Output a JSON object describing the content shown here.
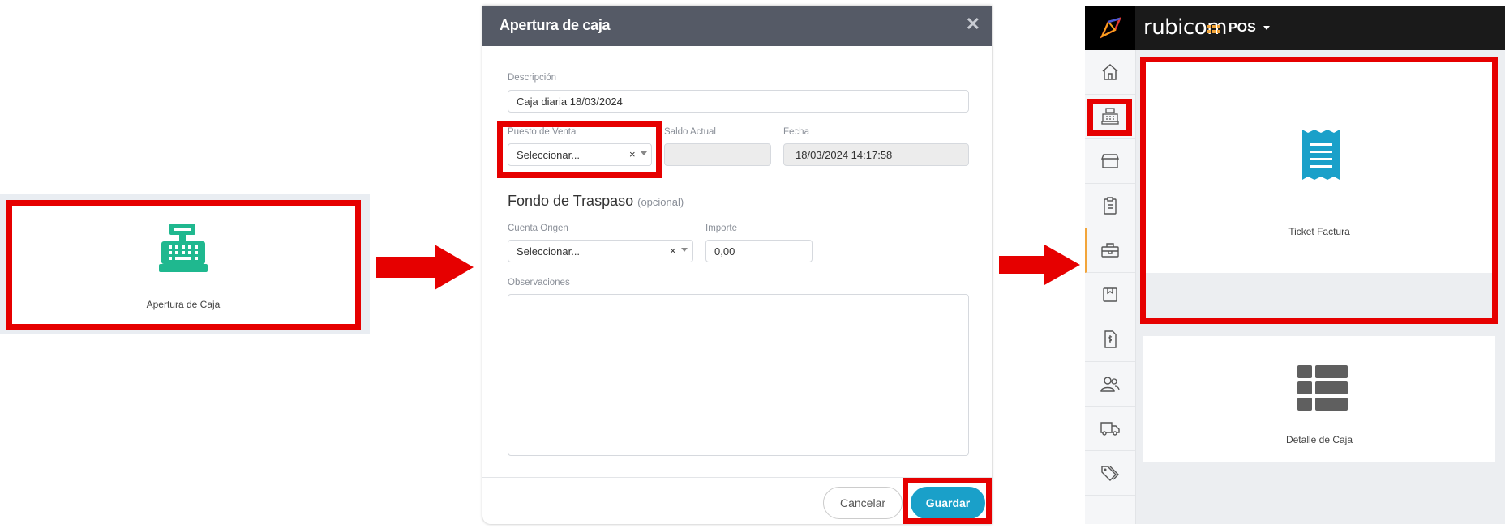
{
  "panel1": {
    "tile_label": "Apertura de Caja"
  },
  "modal": {
    "title": "Apertura de caja",
    "close_glyph": "✕",
    "descripcion_label": "Descripción",
    "descripcion_value": "Caja diaria 18/03/2024",
    "puesto_label": "Puesto de Venta",
    "puesto_value": "Seleccionar...",
    "saldo_label": "Saldo Actual",
    "saldo_value": "",
    "fecha_label": "Fecha",
    "fecha_value": "18/03/2024 14:17:58",
    "section_title": "Fondo de Traspaso",
    "section_optional": "(opcional)",
    "cuenta_label": "Cuenta Origen",
    "cuenta_value": "Seleccionar...",
    "importe_label": "Importe",
    "importe_value": "0,00",
    "observaciones_label": "Observaciones",
    "observaciones_value": "",
    "clear_glyph": "×",
    "cancel_label": "Cancelar",
    "save_label": "Guardar"
  },
  "app": {
    "brand": "rubicom",
    "module": "POS",
    "sidebar_icons": [
      "home-icon",
      "cash-register-icon",
      "store-icon",
      "clipboard-icon",
      "toolbox-icon",
      "box-icon",
      "invoice-icon",
      "users-icon",
      "truck-icon",
      "tags-icon"
    ],
    "tiles": [
      {
        "label": "Ticket Factura",
        "icon": "receipt-icon"
      },
      {
        "label": "Detalle de Caja",
        "icon": "table-icon"
      }
    ]
  },
  "colors": {
    "highlight": "#e60000",
    "accent": "#1aa0c9",
    "register_green": "#1fb88f",
    "active_bar": "#f2a53a"
  }
}
